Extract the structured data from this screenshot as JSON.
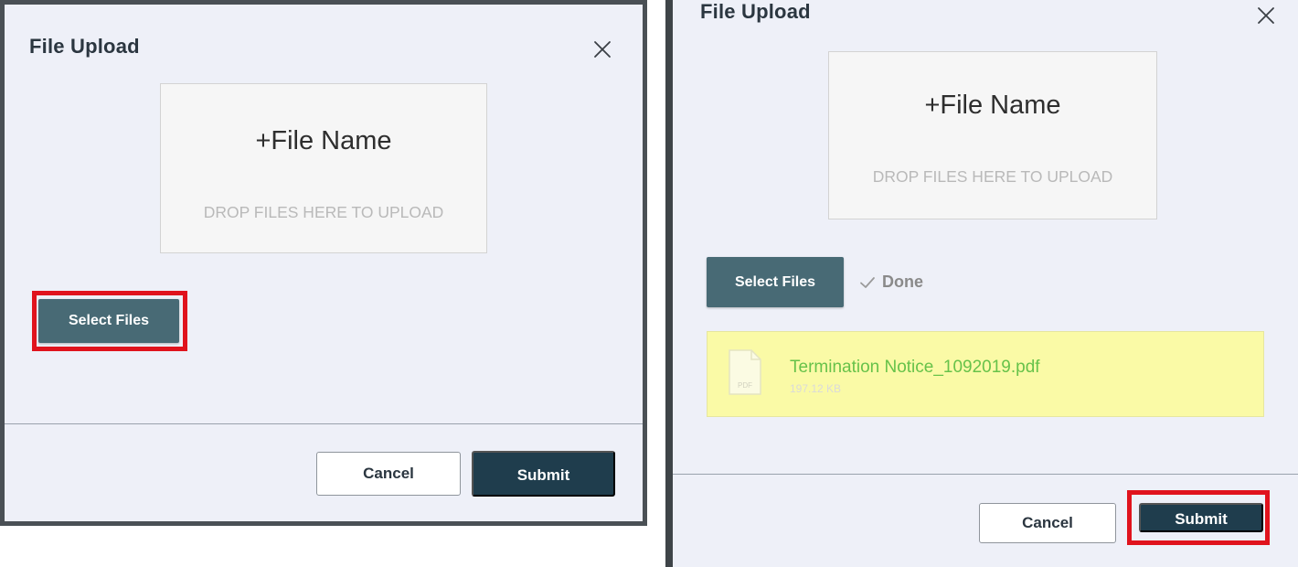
{
  "dialogs": [
    {
      "title": "File Upload",
      "dropzone": {
        "title": "+File Name",
        "hint": "DROP FILES HERE TO UPLOAD"
      },
      "select_label": "Select Files",
      "cancel_label": "Cancel",
      "submit_label": "Submit"
    },
    {
      "title": "File Upload",
      "dropzone": {
        "title": "+File Name",
        "hint": "DROP FILES HERE TO UPLOAD"
      },
      "select_label": "Select Files",
      "status_label": "Done",
      "file": {
        "name": "Termination Notice_1092019.pdf",
        "size": "197.12 KB",
        "icon_label": "PDF",
        "icon": "pdf-file-icon"
      },
      "cancel_label": "Cancel",
      "submit_label": "Submit"
    }
  ],
  "icons": {
    "close": "close-icon",
    "done": "checkmark-icon"
  },
  "colors": {
    "dialog_bg": "#eef0f8",
    "select_button": "#486a75",
    "submit_button": "#1f3d4d",
    "highlight": "#e0131d",
    "file_card_bg": "#fafaa6",
    "file_name": "#67c24a"
  }
}
